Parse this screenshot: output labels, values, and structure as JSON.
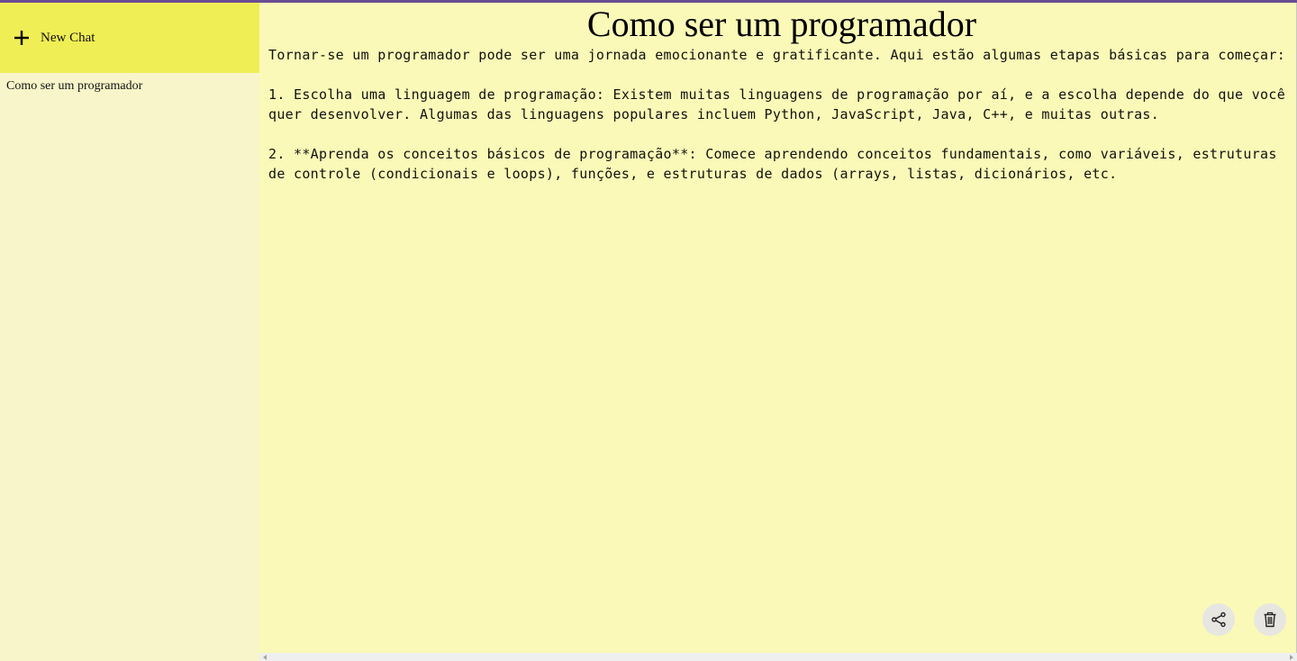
{
  "sidebar": {
    "new_chat_label": "New Chat",
    "new_chat_icon": "plus-icon",
    "history": [
      {
        "label": "Como ser um programador"
      }
    ]
  },
  "main": {
    "title": "Como ser um programador",
    "response": "Tornar-se um programador pode ser uma jornada emocionante e gratificante. Aqui estão algumas etapas básicas para começar:\n\n1. Escolha uma linguagem de programação: Existem muitas linguagens de programação por aí, e a escolha depende do que você quer desenvolver. Algumas das linguagens populares incluem Python, JavaScript, Java, C++, e muitas outras.\n\n2. **Aprenda os conceitos básicos de programação**: Comece aprendendo conceitos fundamentais, como variáveis, estruturas de controle (condicionais e loops), funções, e estruturas de dados (arrays, listas, dicionários, etc.",
    "actions": {
      "share_icon": "share-icon",
      "delete_icon": "trash-icon"
    }
  },
  "colors": {
    "top_bar": "#6a4c93",
    "sidebar_bg": "#f7f5c9",
    "new_chat_bg": "#f0ee55",
    "main_bg": "#faf9b7",
    "action_button_bg": "#e7e6e1"
  }
}
